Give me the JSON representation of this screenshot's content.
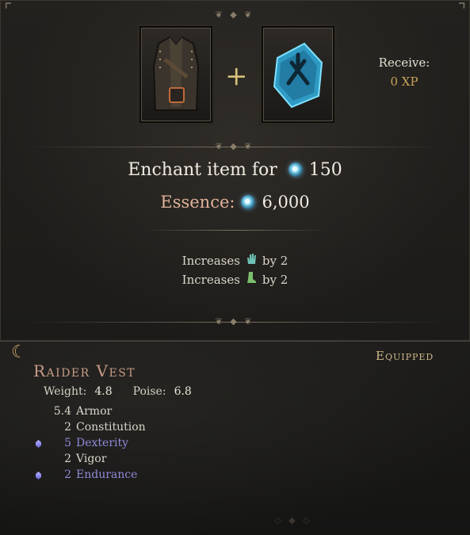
{
  "receive": {
    "label": "Receive:",
    "value": "0 XP"
  },
  "enchant": {
    "label": "Enchant item for",
    "cost": "150"
  },
  "essence": {
    "label": "Essence:",
    "amount": "6,000"
  },
  "increases": [
    {
      "label": "Increases",
      "icon": "hand-icon",
      "suffix": "by 2"
    },
    {
      "label": "Increases",
      "icon": "boot-icon",
      "suffix": "by 2"
    }
  ],
  "item": {
    "status": "Equipped",
    "name": "Raider Vest",
    "weight_label": "Weight:",
    "weight": "4.8",
    "poise_label": "Poise:",
    "poise": "6.8",
    "attributes": [
      {
        "value": "5.4",
        "name": "Armor",
        "highlight": false
      },
      {
        "value": "2",
        "name": "Constitution",
        "highlight": false
      },
      {
        "value": "5",
        "name": "Dexterity",
        "highlight": true
      },
      {
        "value": "2",
        "name": "Vigor",
        "highlight": false
      },
      {
        "value": "2",
        "name": "Endurance",
        "highlight": true
      }
    ]
  },
  "colors": {
    "gold": "#c9a45a",
    "essence": "#e0b29a",
    "upgraded": "#8f8bd9",
    "item_name": "#c89b86"
  }
}
